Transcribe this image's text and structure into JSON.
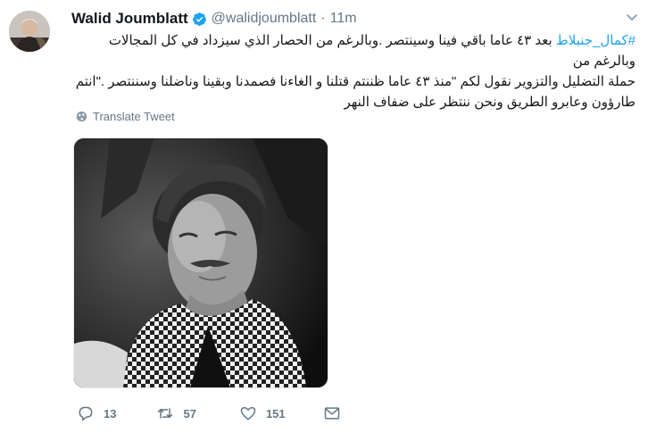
{
  "tweet": {
    "author_name": "Walid Joumblatt",
    "handle": "@walidjoumblatt",
    "separator": "·",
    "time": "11m",
    "hashtag": "#كمال_جنبلاط",
    "text_line1_rest": " بعد ٤٣ عاما باقي فينا وسينتصر .وبالرغم من الحصار الذي سيزداد في كل المجالات وبالرغم من",
    "text_line2": "حملة التضليل والتزوير   نقول لكم \"منذ ٤٣ عاما ظننتم قتلنا و الغاءنا فصمدنا وبقينا  وناضلنا وسننتصر .\"انتم",
    "text_line3": "طارؤون وعابرو الطريق ونحن ننتظر على ضفاف النهر",
    "translate_label": "Translate Tweet",
    "reply_count": "13",
    "retweet_count": "57",
    "like_count": "151"
  },
  "colors": {
    "accent": "#1da1f2",
    "muted": "#657786",
    "text": "#14171a"
  },
  "icons": {
    "verified": "verified-badge-icon",
    "menu": "chevron-down-icon",
    "translate": "globe-icon",
    "reply": "reply-icon",
    "retweet": "retweet-icon",
    "like": "heart-icon",
    "dm": "envelope-icon"
  }
}
